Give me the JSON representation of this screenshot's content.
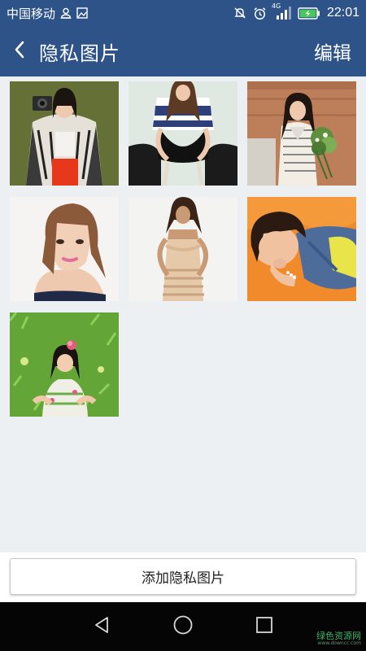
{
  "status_bar": {
    "carrier": "中国移动",
    "network": "4G",
    "time": "22:01",
    "icons": [
      "person-icon",
      "image-icon",
      "mute-icon",
      "alarm-icon",
      "signal-icon",
      "battery-charging-icon"
    ]
  },
  "header": {
    "title": "隐私图片",
    "edit_label": "编辑",
    "back_icon": "chevron-left-icon"
  },
  "gallery": {
    "photos": [
      {
        "name": "photo-1",
        "desc": "woman with camera, patterned cardigan"
      },
      {
        "name": "photo-2",
        "desc": "woman seated on chair, striped top"
      },
      {
        "name": "photo-3",
        "desc": "woman with flower bouquet"
      },
      {
        "name": "photo-4",
        "desc": "woman portrait, white background"
      },
      {
        "name": "photo-5",
        "desc": "woman in beige dress"
      },
      {
        "name": "photo-6",
        "desc": "woman lying on orange background"
      },
      {
        "name": "photo-7",
        "desc": "girl crouching in grass"
      }
    ]
  },
  "footer": {
    "add_label": "添加隐私图片"
  },
  "nav": {
    "back_icon": "triangle-back-icon",
    "home_icon": "circle-home-icon",
    "recent_icon": "square-recents-icon"
  },
  "watermark": {
    "main": "绿色资源网",
    "sub": "www.downcc.com"
  },
  "colors": {
    "header_bg": "#2d5388",
    "page_bg": "#edf0f2",
    "nav_bg": "#050505"
  }
}
